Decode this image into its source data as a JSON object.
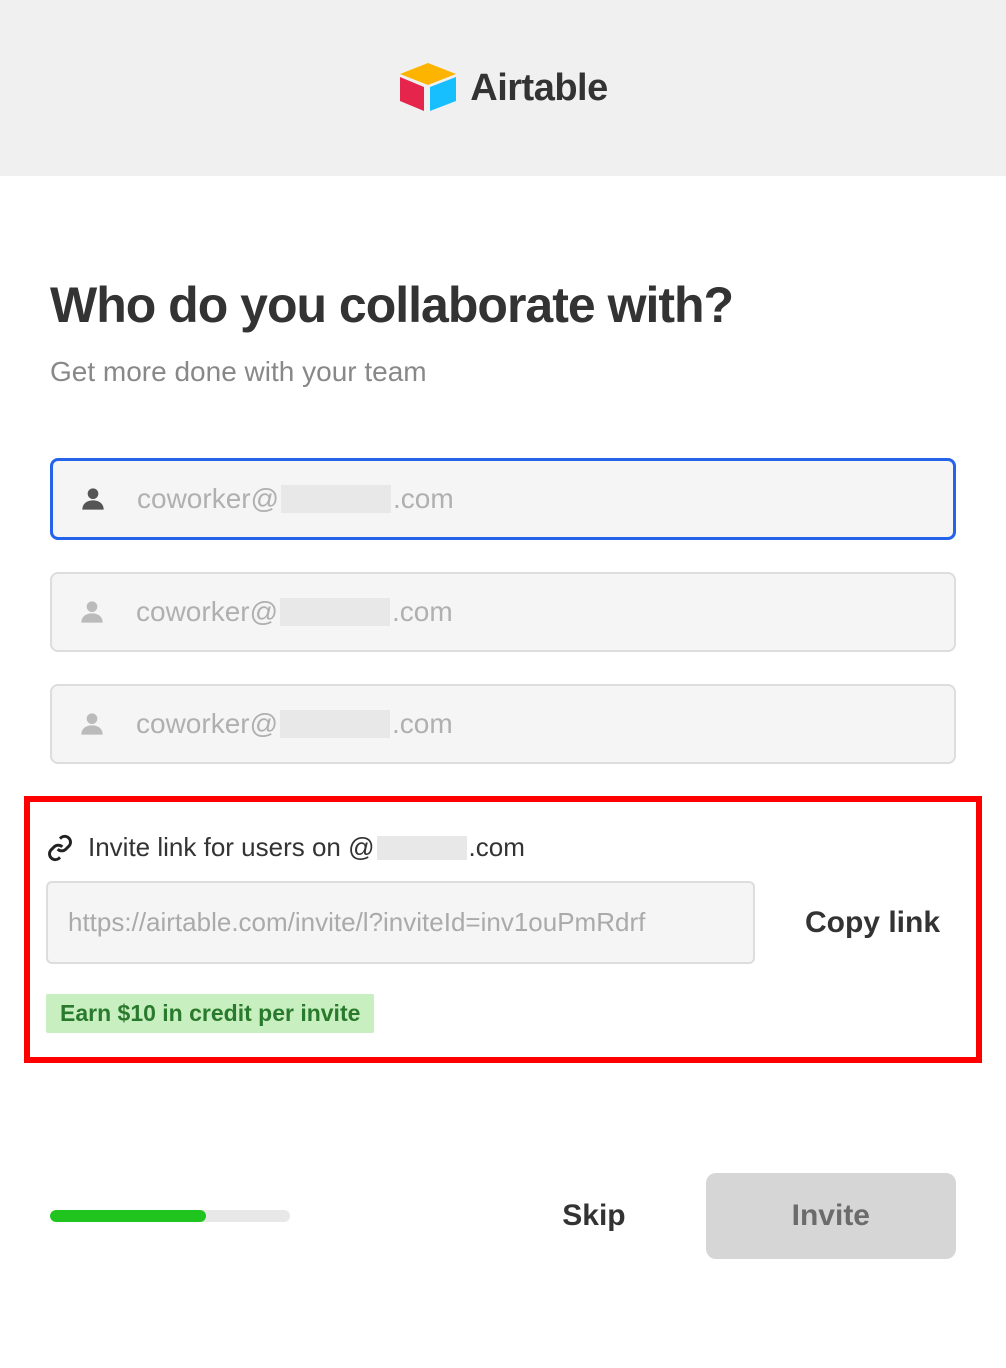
{
  "brand": {
    "name": "Airtable"
  },
  "heading": "Who do you collaborate with?",
  "subheading": "Get more done with your team",
  "emailInputs": [
    {
      "placeholder_prefix": "coworker@",
      "placeholder_suffix": ".com",
      "focused": true
    },
    {
      "placeholder_prefix": "coworker@",
      "placeholder_suffix": ".com",
      "focused": false
    },
    {
      "placeholder_prefix": "coworker@",
      "placeholder_suffix": ".com",
      "focused": false
    }
  ],
  "inviteSection": {
    "label_prefix": "Invite link for users on @",
    "label_suffix": ".com",
    "url": "https://airtable.com/invite/l?inviteId=inv1ouPmRdrf",
    "copyLabel": "Copy link",
    "creditBadge": "Earn $10 in credit per invite"
  },
  "footer": {
    "skipLabel": "Skip",
    "inviteLabel": "Invite",
    "progressPercent": 65
  }
}
